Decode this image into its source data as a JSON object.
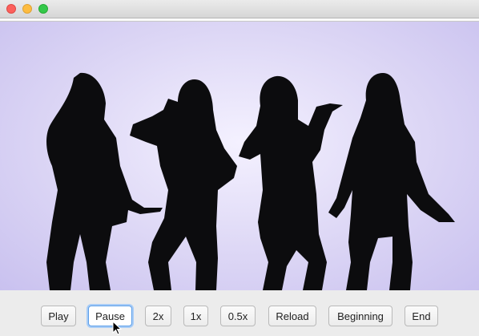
{
  "window": {
    "controls": [
      "close",
      "minimize",
      "zoom"
    ]
  },
  "video": {
    "content": "silhouettes-of-four-women"
  },
  "controls": {
    "buttons": [
      {
        "label": "Play"
      },
      {
        "label": "Pause",
        "focused": true
      },
      {
        "label": "2x"
      },
      {
        "label": "1x"
      },
      {
        "label": "0.5x"
      },
      {
        "label": "Reload"
      },
      {
        "label": "Beginning"
      },
      {
        "label": "End"
      }
    ]
  }
}
